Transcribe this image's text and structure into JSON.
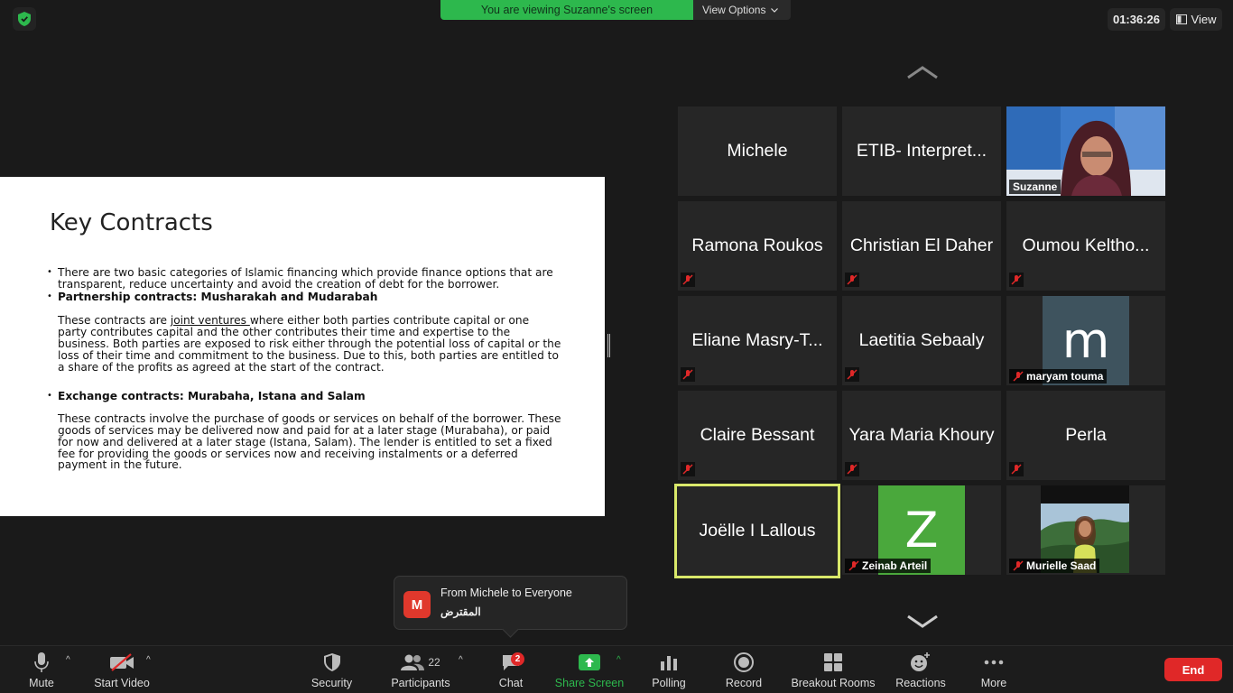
{
  "top_bar": {
    "viewing_text": "You are viewing Suzanne's screen",
    "view_options_label": "View Options",
    "timer": "01:36:26",
    "view_label": "View"
  },
  "slide": {
    "title": "Key Contracts",
    "bullet1": "There are two basic categories of Islamic financing which provide finance options that are transparent, reduce uncertainty and avoid the creation of debt for the borrower.",
    "bullet2": "Partnership contracts: Musharakah and Mudarabah",
    "para2_before": "These contracts are ",
    "para2_link": "joint ventures ",
    "para2_after": "where either both parties contribute capital or one party contributes capital and the other contributes their time and expertise to the business. Both parties are exposed to risk either through the potential loss of capital or the loss of their time and commitment to the business. Due to this, both parties are entitled to a share of the profits as agreed at the start of the contract.",
    "bullet3": "Exchange contracts: Murabaha, Istana and Salam",
    "para3": "These contracts involve the purchase of goods or services on behalf of the borrower. These goods of services may be delivered now and paid for at a later stage (Murabaha), or paid for now and delivered at a later stage (Istana, Salam). The lender is entitled to set a fixed fee for providing the goods or services now and receiving instalments or a deferred payment in the future."
  },
  "gallery": {
    "participants": [
      {
        "name": "Michele"
      },
      {
        "name": "ETIB- Interpret..."
      },
      {
        "name": "Suzanne"
      },
      {
        "name": "Ramona Roukos"
      },
      {
        "name": "Christian El Daher"
      },
      {
        "name": "Oumou Keltho..."
      },
      {
        "name": "Eliane Masry-T..."
      },
      {
        "name": "Laetitia Sebaaly"
      },
      {
        "name": "maryam touma",
        "avatar_letter": "m"
      },
      {
        "name": "Claire Bessant"
      },
      {
        "name": "Yara Maria Khoury"
      },
      {
        "name": "Perla"
      },
      {
        "name": "Joëlle I Lallous"
      },
      {
        "name": "Zeinab Arteil",
        "avatar_letter": "Z"
      },
      {
        "name": "Murielle Saad"
      }
    ]
  },
  "chat_popup": {
    "avatar_letter": "M",
    "from": "From Michele to Everyone",
    "message": "المقترض"
  },
  "toolbar": {
    "mute": "Mute",
    "start_video": "Start Video",
    "security": "Security",
    "participants": "Participants",
    "participant_count": "22",
    "chat": "Chat",
    "chat_badge": "2",
    "share_screen": "Share Screen",
    "polling": "Polling",
    "record": "Record",
    "breakout_rooms": "Breakout Rooms",
    "reactions": "Reactions",
    "more": "More",
    "end": "End"
  },
  "colors": {
    "accent_green": "#2db84d",
    "end_red": "#e02828",
    "active_speaker": "#d9e86a"
  }
}
